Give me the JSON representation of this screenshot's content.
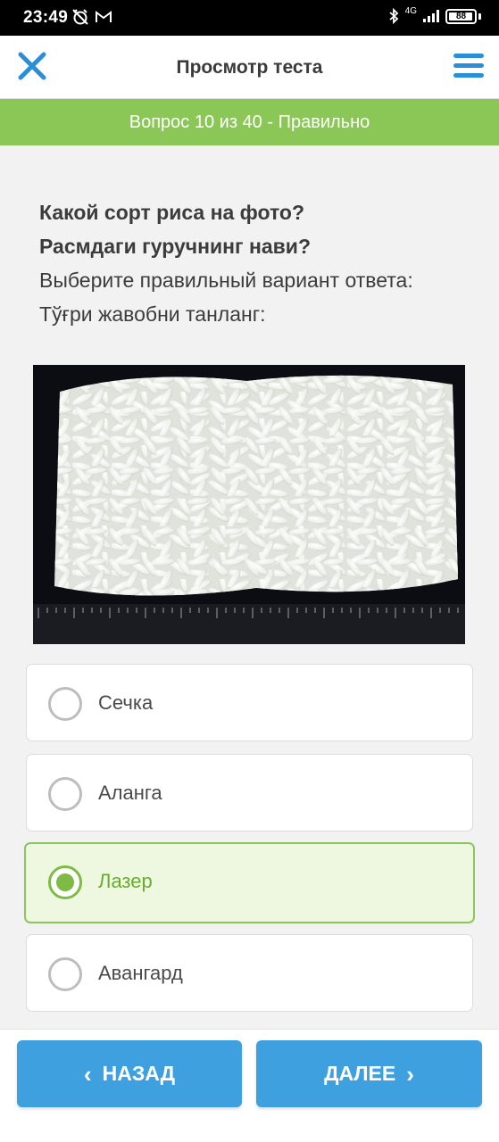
{
  "status_bar": {
    "time": "23:49",
    "network": "4G",
    "battery": "88"
  },
  "app_bar": {
    "title": "Просмотр теста",
    "close_icon": "close-icon",
    "menu_icon": "hamburger-menu-icon"
  },
  "question_banner": {
    "text": "Вопрос 10 из 40 - Правильно"
  },
  "question": {
    "line1": "Какой сорт риса на фото?",
    "line2": "Расмдаги гуручнинг нави?",
    "line3": "Выберите правильный вариант ответа:",
    "line4": "Тўғри жавобни танланг:"
  },
  "options": [
    {
      "label": "Сечка",
      "selected": false
    },
    {
      "label": "Аланга",
      "selected": false
    },
    {
      "label": "Лазер",
      "selected": true
    },
    {
      "label": "Авангард",
      "selected": false
    }
  ],
  "footer": {
    "back_label": "НАЗАД",
    "next_label": "ДАЛЕЕ"
  },
  "colors": {
    "accent_green": "#8bc757",
    "button_blue": "#3fa0e0",
    "icon_blue": "#2a8fd6"
  }
}
